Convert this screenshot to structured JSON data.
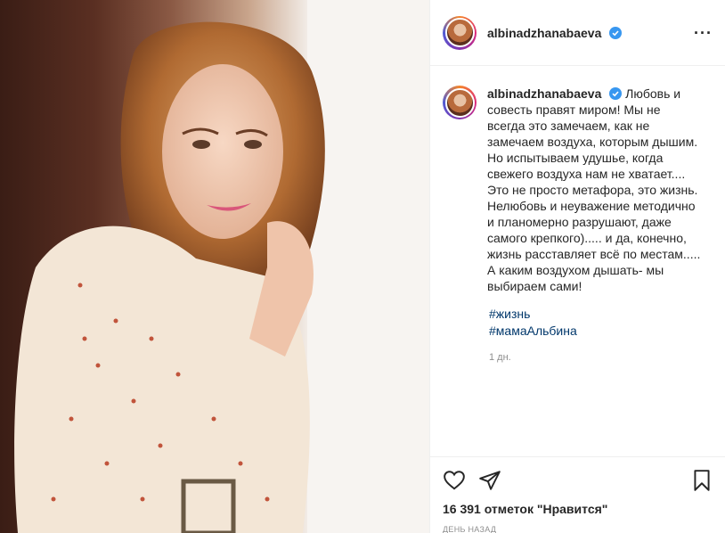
{
  "post": {
    "username": "albinadzhanabaeva",
    "caption": "Любовь и совесть правят миром! Мы не всегда это замечаем, как не замечаем воздуха, которым дышим. Но испытываем удушье, когда свежего воздуха нам не хватает.... Это не просто метафора, это жизнь. Нелюбовь и неуважение методично и планомерно разрушают, даже самого крепкого)..... и да, конечно, жизнь расставляет всё по местам..... А каким воздухом дышать- мы выбираем сами!",
    "hashtags": [
      "#жизнь",
      "#мамаАльбина"
    ],
    "time_ago": "1 дн.",
    "likes": "16 391 отметок \"Нравится\"",
    "posted": "ДЕНЬ НАЗАД"
  },
  "icons": {
    "verified": "verified-badge-icon",
    "more": "more-options-icon",
    "like": "heart-icon",
    "share": "paper-plane-icon",
    "save": "bookmark-icon"
  },
  "colors": {
    "text": "#262626",
    "muted": "#8e8e8e",
    "link": "#00376b",
    "verified": "#3897f0"
  }
}
